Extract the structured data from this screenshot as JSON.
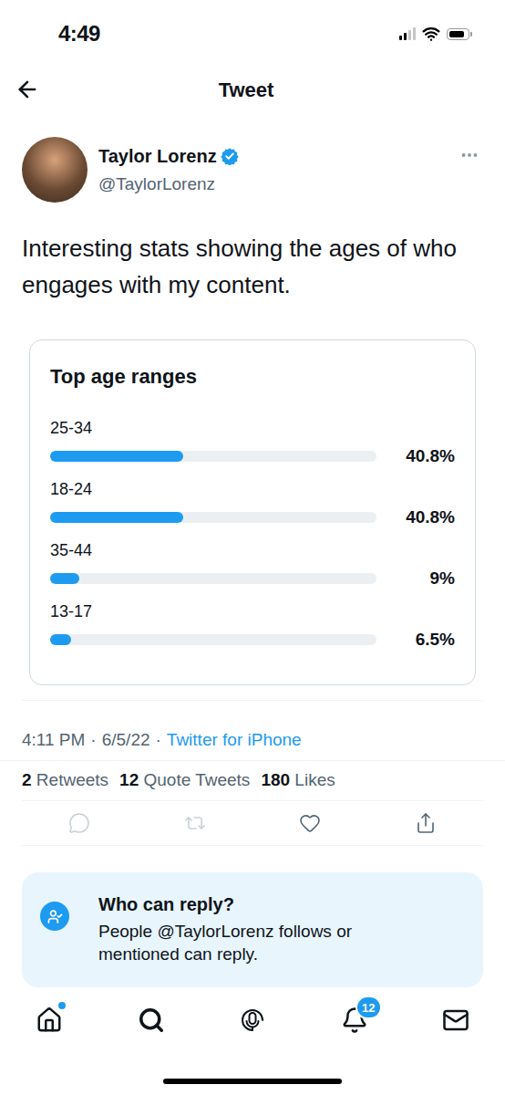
{
  "status_bar": {
    "time": "4:49",
    "signal": {
      "level": 0.5
    },
    "battery": {
      "level": 0.85
    }
  },
  "header": {
    "title": "Tweet"
  },
  "tweet": {
    "author": {
      "name": "Taylor Lorenz",
      "handle": "@TaylorLorenz",
      "verified": true
    },
    "text": "Interesting stats showing the ages of who engages with my content.",
    "card": {
      "title": "Top age ranges",
      "rows": [
        {
          "label": "25-34",
          "value": "40.8%",
          "level": 0.408
        },
        {
          "label": "18-24",
          "value": "40.8%",
          "level": 0.408
        },
        {
          "label": "35-44",
          "value": "9%",
          "level": 0.09
        },
        {
          "label": "13-17",
          "value": "6.5%",
          "level": 0.065
        }
      ]
    },
    "meta": {
      "time": "4:11 PM",
      "separator": "·",
      "date": "6/5/22",
      "source": "Twitter for iPhone"
    },
    "stats": [
      {
        "count": "2",
        "label": "Retweets"
      },
      {
        "count": "12",
        "label": "Quote Tweets"
      },
      {
        "count": "180",
        "label": "Likes"
      }
    ],
    "actions": [
      {
        "kind": "reply",
        "disabled": true
      },
      {
        "kind": "retweet",
        "disabled": true
      },
      {
        "kind": "like",
        "disabled": false
      },
      {
        "kind": "share",
        "disabled": false
      }
    ]
  },
  "reply_settings": {
    "title": "Who can reply?",
    "text": "People @TaylorLorenz follows or mentioned can reply."
  },
  "tab_bar": [
    {
      "kind": "home",
      "selected": false,
      "unread": true
    },
    {
      "kind": "search",
      "selected": true,
      "unread": false
    },
    {
      "kind": "spaces",
      "selected": false,
      "unread": false
    },
    {
      "kind": "notifications",
      "selected": false,
      "unread": false,
      "badge": "12"
    },
    {
      "kind": "messages",
      "selected": false,
      "unread": false
    }
  ]
}
